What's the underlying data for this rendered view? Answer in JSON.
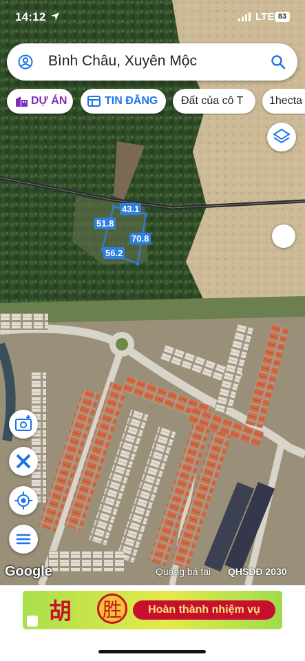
{
  "status_bar": {
    "time": "14:12",
    "network": "LTE",
    "battery": "83"
  },
  "search": {
    "query": "Bình Châu, Xuyên Mộc",
    "account_icon": "account-icon",
    "search_icon": "search-icon"
  },
  "chips": [
    {
      "label": "DỰ ÁN",
      "icon": "building-icon"
    },
    {
      "label": "TIN ĐĂNG",
      "icon": "listing-icon"
    },
    {
      "label": "Đất của cô T"
    },
    {
      "label": "1hecta"
    }
  ],
  "parcel": {
    "sides": [
      "43.1",
      "51.8",
      "70.8",
      "56.2"
    ],
    "color": "#2f7fe0"
  },
  "map_watermark": "Quảng bá tại",
  "plan_code": "QHSDĐ 2030",
  "attribution": "Google",
  "ad": {
    "glyph1": "胡",
    "glyph2": "胜",
    "mission": "Hoàn thành nhiệm vụ"
  }
}
